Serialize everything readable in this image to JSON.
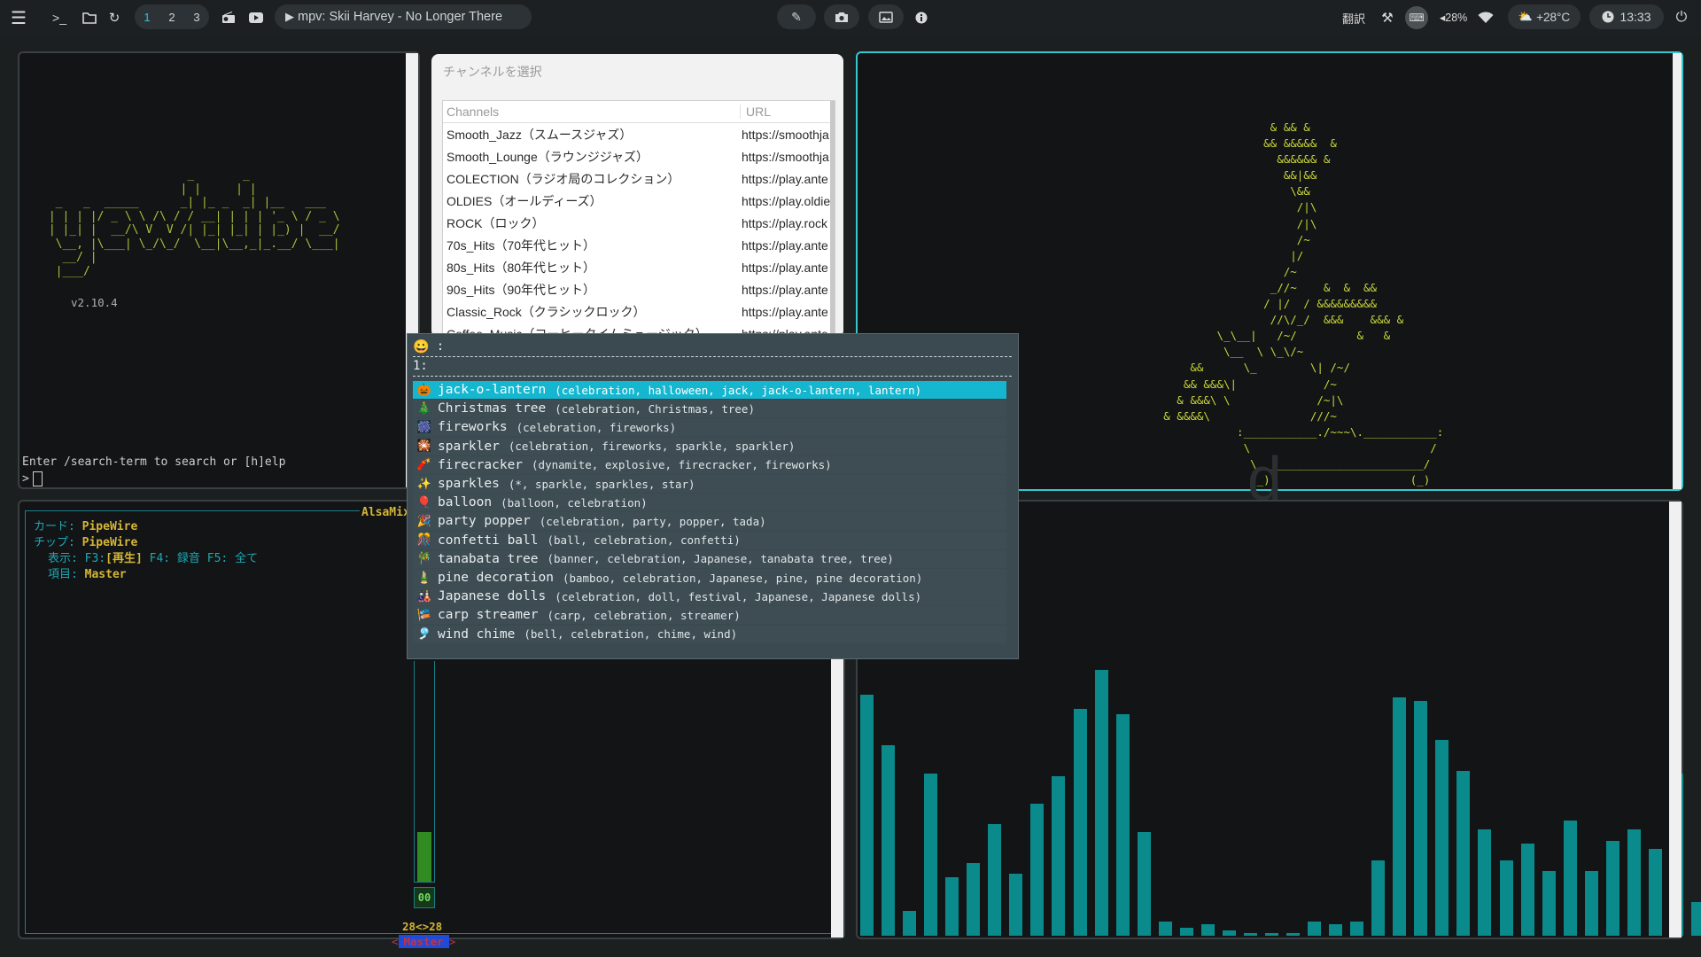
{
  "topbar": {
    "menu_icon": "hamburger-icon",
    "terminal_icon": "terminal-prompt-icon",
    "folder_icon": "folder-icon",
    "refresh_icon": "refresh-icon",
    "workspaces": [
      "1",
      "2",
      "3"
    ],
    "active_workspace": "1",
    "radio_icon": "radio-icon",
    "youtube_icon": "youtube-icon",
    "media_label": "mpv:  Skii Harvey - No Longer There",
    "right": {
      "translate": "翻訳",
      "volume": "◂28%",
      "weather": "+28°C",
      "clock": "13:33"
    }
  },
  "neofetch": {
    "version": "v2.10.4",
    "prompt": "Enter /search-term to search or [h]elp",
    "cursor": ">"
  },
  "channel_dialog": {
    "title": "チャンネルを選択",
    "columns": [
      "Channels",
      "URL"
    ],
    "rows": [
      [
        "Smooth_Jazz（スムースジャズ）",
        "https://smoothja"
      ],
      [
        "Smooth_Lounge（ラウンジジャズ）",
        "https://smoothja"
      ],
      [
        "COLECTION（ラジオ局のコレクション）",
        "https://play.ante"
      ],
      [
        "OLDIES（オールディーズ）",
        "https://play.oldie"
      ],
      [
        "ROCK（ロック）",
        "https://play.rock"
      ],
      [
        "70s_Hits（70年代ヒット）",
        "https://play.ante"
      ],
      [
        "80s_Hits（80年代ヒット）",
        "https://play.ante"
      ],
      [
        "90s_Hits（90年代ヒット）",
        "https://play.ante"
      ],
      [
        "Classic_Rock（クラシックロック）",
        "https://play.ante"
      ],
      [
        "Coffee_Music（コーヒータイムミュージック）",
        "https://play.ante"
      ]
    ]
  },
  "alsamixer": {
    "title": "AlsaMix",
    "card_label": "カード:",
    "card_value": "PipeWire",
    "chip_label": "チップ:",
    "chip_value": "PipeWire",
    "view_label": "表示:",
    "view_f3": "F3:[再生]",
    "view_f4": "F4: 録音",
    "view_f5": "F5: 全て",
    "item_label": "項目:",
    "item_value": "Master",
    "level": "00",
    "levels": "28<>28",
    "channel": "Master",
    "volume_fraction": 0.28
  },
  "emoji_picker": {
    "prompt_icon": "😀",
    "prompt": ":",
    "query": "1:",
    "items": [
      {
        "emoji": "🎃",
        "name": "jack-o-lantern",
        "keywords": "(celebration, halloween, jack, jack-o-lantern, lantern)",
        "selected": true
      },
      {
        "emoji": "🎄",
        "name": "Christmas tree",
        "keywords": "(celebration, Christmas, tree)"
      },
      {
        "emoji": "🎆",
        "name": "fireworks",
        "keywords": "(celebration, fireworks)"
      },
      {
        "emoji": "🎇",
        "name": "sparkler",
        "keywords": "(celebration, fireworks, sparkle, sparkler)"
      },
      {
        "emoji": "🧨",
        "name": "firecracker",
        "keywords": "(dynamite, explosive, firecracker, fireworks)"
      },
      {
        "emoji": "✨",
        "name": "sparkles",
        "keywords": "(*, sparkle, sparkles, star)"
      },
      {
        "emoji": "🎈",
        "name": "balloon",
        "keywords": "(balloon, celebration)"
      },
      {
        "emoji": "🎉",
        "name": "party popper",
        "keywords": "(celebration, party, popper, tada)"
      },
      {
        "emoji": "🎊",
        "name": "confetti ball",
        "keywords": "(ball, celebration, confetti)"
      },
      {
        "emoji": "🎋",
        "name": "tanabata tree",
        "keywords": "(banner, celebration, Japanese, tanabata tree, tree)"
      },
      {
        "emoji": "🎍",
        "name": "pine decoration",
        "keywords": "(bamboo, celebration, Japanese, pine, pine decoration)"
      },
      {
        "emoji": "🎎",
        "name": "Japanese dolls",
        "keywords": "(celebration, doll, festival, Japanese, Japanese dolls)"
      },
      {
        "emoji": "🎏",
        "name": "carp streamer",
        "keywords": "(carp, celebration, streamer)"
      },
      {
        "emoji": "🎐",
        "name": "wind chime",
        "keywords": "(bell, celebration, chime, wind)"
      }
    ]
  },
  "visualizer": {
    "levels": [
      0.86,
      0.68,
      0.09,
      0.58,
      0.21,
      0.26,
      0.4,
      0.22,
      0.47,
      0.57,
      0.81,
      0.95,
      0.79,
      0.37,
      0.05,
      0.03,
      0.04,
      0.02,
      0.01,
      0.01,
      0.01,
      0.05,
      0.04,
      0.05,
      0.27,
      0.85,
      0.84,
      0.7,
      0.59,
      0.38,
      0.27,
      0.33,
      0.23,
      0.41,
      0.23,
      0.34,
      0.38,
      0.31,
      0.58,
      0.12,
      0.56,
      0.81,
      0.86
    ]
  }
}
